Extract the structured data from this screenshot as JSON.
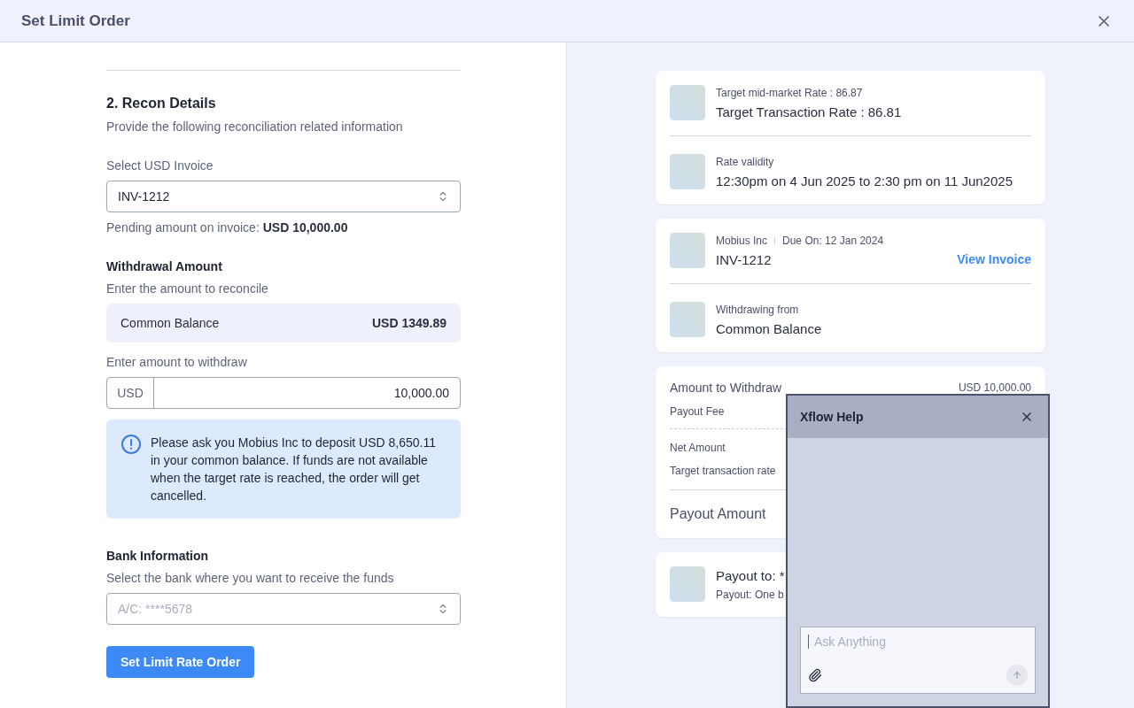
{
  "window": {
    "title": "Set Limit Order"
  },
  "recon": {
    "heading": "2. Recon Details",
    "subtitle": "Provide the following reconciliation related information",
    "invoice_label": "Select USD Invoice",
    "invoice_value": "INV-1212",
    "pending_prefix": "Pending amount on invoice: ",
    "pending_amount": "USD 10,000.00",
    "withdrawal_heading": "Withdrawal Amount",
    "withdrawal_subtitle": "Enter the amount to reconcile",
    "balance": {
      "label": "Common Balance",
      "amount": "USD 1349.89"
    },
    "amount_label": "Enter amount to withdraw",
    "currency": "USD",
    "amount_value": "10,000.00",
    "alert": "Please ask you Mobius Inc to deposit USD 8,650.11 in your common balance. If funds are not available when the target rate is reached, the order will get cancelled.",
    "bank_heading": "Bank Information",
    "bank_subtitle": "Select the bank where you want to receive the funds",
    "bank_placeholder": "A/C: ****5678",
    "submit": "Set Limit Rate Order"
  },
  "summary": {
    "cards": [
      {
        "rows": [
          {
            "small": "Target mid-market Rate : 86.87",
            "main": "Target Transaction Rate : 86.81"
          },
          {
            "small": "Rate validity",
            "main": "12:30pm on 4 Jun 2025 to 2:30 pm on 11 Jun2025"
          }
        ]
      },
      {
        "rows": [
          {
            "small": "Mobius Inc",
            "small_extra": "Due On: 12 Jan 2024",
            "main": "INV-1212",
            "link": "View Invoice"
          },
          {
            "small": "Withdrawing from",
            "main": "Common Balance"
          }
        ]
      }
    ],
    "amounts": {
      "withdraw_label": "Amount to Withdraw",
      "withdraw_value": "USD 10,000.00",
      "fee_label": "Payout Fee",
      "net_label": "Net Amount",
      "rate_label": "Target transaction rate",
      "payout_label": "Payout Amount"
    },
    "payout": {
      "main": "Payout to: *",
      "small": "Payout: One b"
    }
  },
  "help": {
    "title": "Xflow Help",
    "placeholder": "Ask Anything"
  }
}
